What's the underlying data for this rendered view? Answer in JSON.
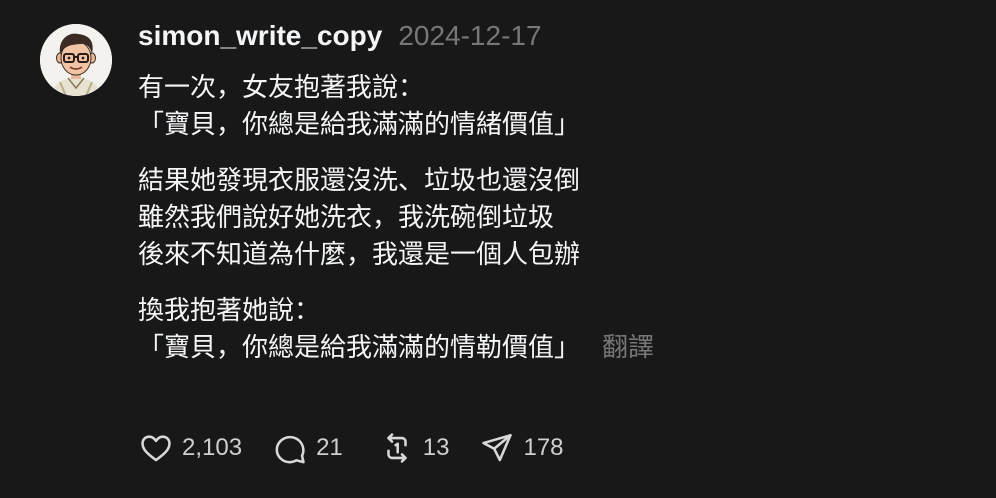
{
  "post": {
    "username": "simon_write_copy",
    "date": "2024-12-17",
    "paragraphs": [
      {
        "lines": [
          "有一次，女友抱著我說：",
          "「寶貝，你總是給我滿滿的情緒價值」"
        ]
      },
      {
        "lines": [
          "結果她發現衣服還沒洗、垃圾也還沒倒",
          "雖然我們說好她洗衣，我洗碗倒垃圾",
          "後來不知道為什麼，我還是一個人包辦"
        ]
      },
      {
        "lines": [
          "換我抱著她說：",
          "「寶貝，你總是給我滿滿的情勒價值」"
        ]
      }
    ],
    "translate_label": "翻譯"
  },
  "actions": {
    "like_icon": "heart-icon",
    "like_count": "2,103",
    "comment_icon": "comment-icon",
    "comment_count": "21",
    "repost_icon": "repost-icon",
    "repost_count": "13",
    "share_icon": "send-icon",
    "share_count": "178"
  },
  "colors": {
    "background": "#181818",
    "text": "#f3f5f7",
    "muted": "#777777"
  }
}
